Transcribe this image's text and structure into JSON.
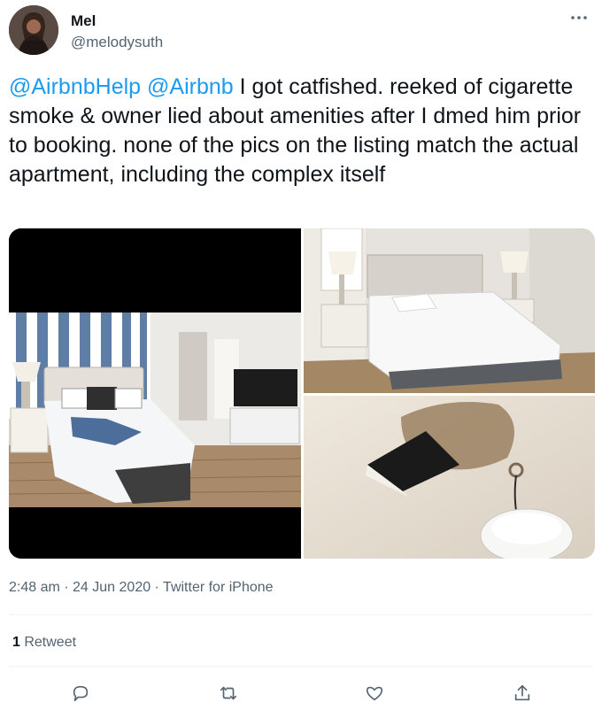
{
  "user": {
    "name": "Mel",
    "handle": "@melodysuth"
  },
  "tweet": {
    "mention_1": "@AirbnbHelp",
    "mention_2": "@Airbnb",
    "body": " I got catfished. reeked of cigarette smoke & owner lied about amenities after I dmed him prior to booking. none of the pics on the listing match the actual apartment,  including the complex itself"
  },
  "media": [
    {
      "icon": "listing-bedroom-photo"
    },
    {
      "icon": "actual-bedroom-photo"
    },
    {
      "icon": "damaged-ceiling-photo"
    }
  ],
  "meta": {
    "time": "2:48 am",
    "sep1": " · ",
    "date": "24 Jun 2020",
    "sep2": " · ",
    "source": "Twitter for iPhone"
  },
  "engagement": {
    "retweet_count": "1",
    "retweet_label": " Retweet"
  },
  "actions": {
    "reply_icon": "reply-icon",
    "retweet_icon": "retweet-icon",
    "like_icon": "like-icon",
    "share_icon": "share-icon"
  },
  "colors": {
    "link": "#1d9bf0",
    "secondary_text": "#536471",
    "primary_text": "#0f1419"
  }
}
